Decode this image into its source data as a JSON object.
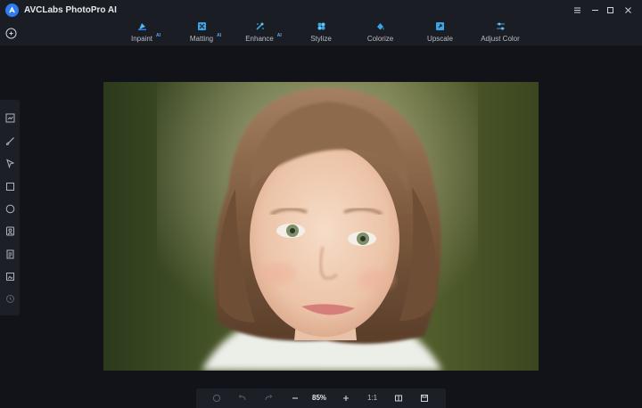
{
  "app": {
    "title": "AVCLabs PhotoPro AI"
  },
  "tools": [
    {
      "label": "Inpaint",
      "ai": "AI",
      "icon": "inpaint-icon"
    },
    {
      "label": "Matting",
      "ai": "AI",
      "icon": "matting-icon"
    },
    {
      "label": "Enhance",
      "ai": "AI",
      "icon": "enhance-icon"
    },
    {
      "label": "Stylize",
      "icon": "stylize-icon"
    },
    {
      "label": "Colorize",
      "icon": "colorize-icon"
    },
    {
      "label": "Upscale",
      "icon": "upscale-icon"
    },
    {
      "label": "Adjust Color",
      "icon": "adjust-color-icon"
    }
  ],
  "side_tools": [
    "compare-icon",
    "brush-icon",
    "pointer-icon",
    "rectangle-icon",
    "ellipse-icon",
    "portrait-select-icon",
    "document-icon",
    "image-select-icon",
    "history-icon"
  ],
  "bottom": {
    "zoom": "85%",
    "ratio": "1:1"
  },
  "colors": {
    "accent": "#2f7cf0",
    "ai_badge": "#5aa8ff",
    "toolbar_bg": "#1a1d24",
    "canvas_bg": "#111318"
  }
}
